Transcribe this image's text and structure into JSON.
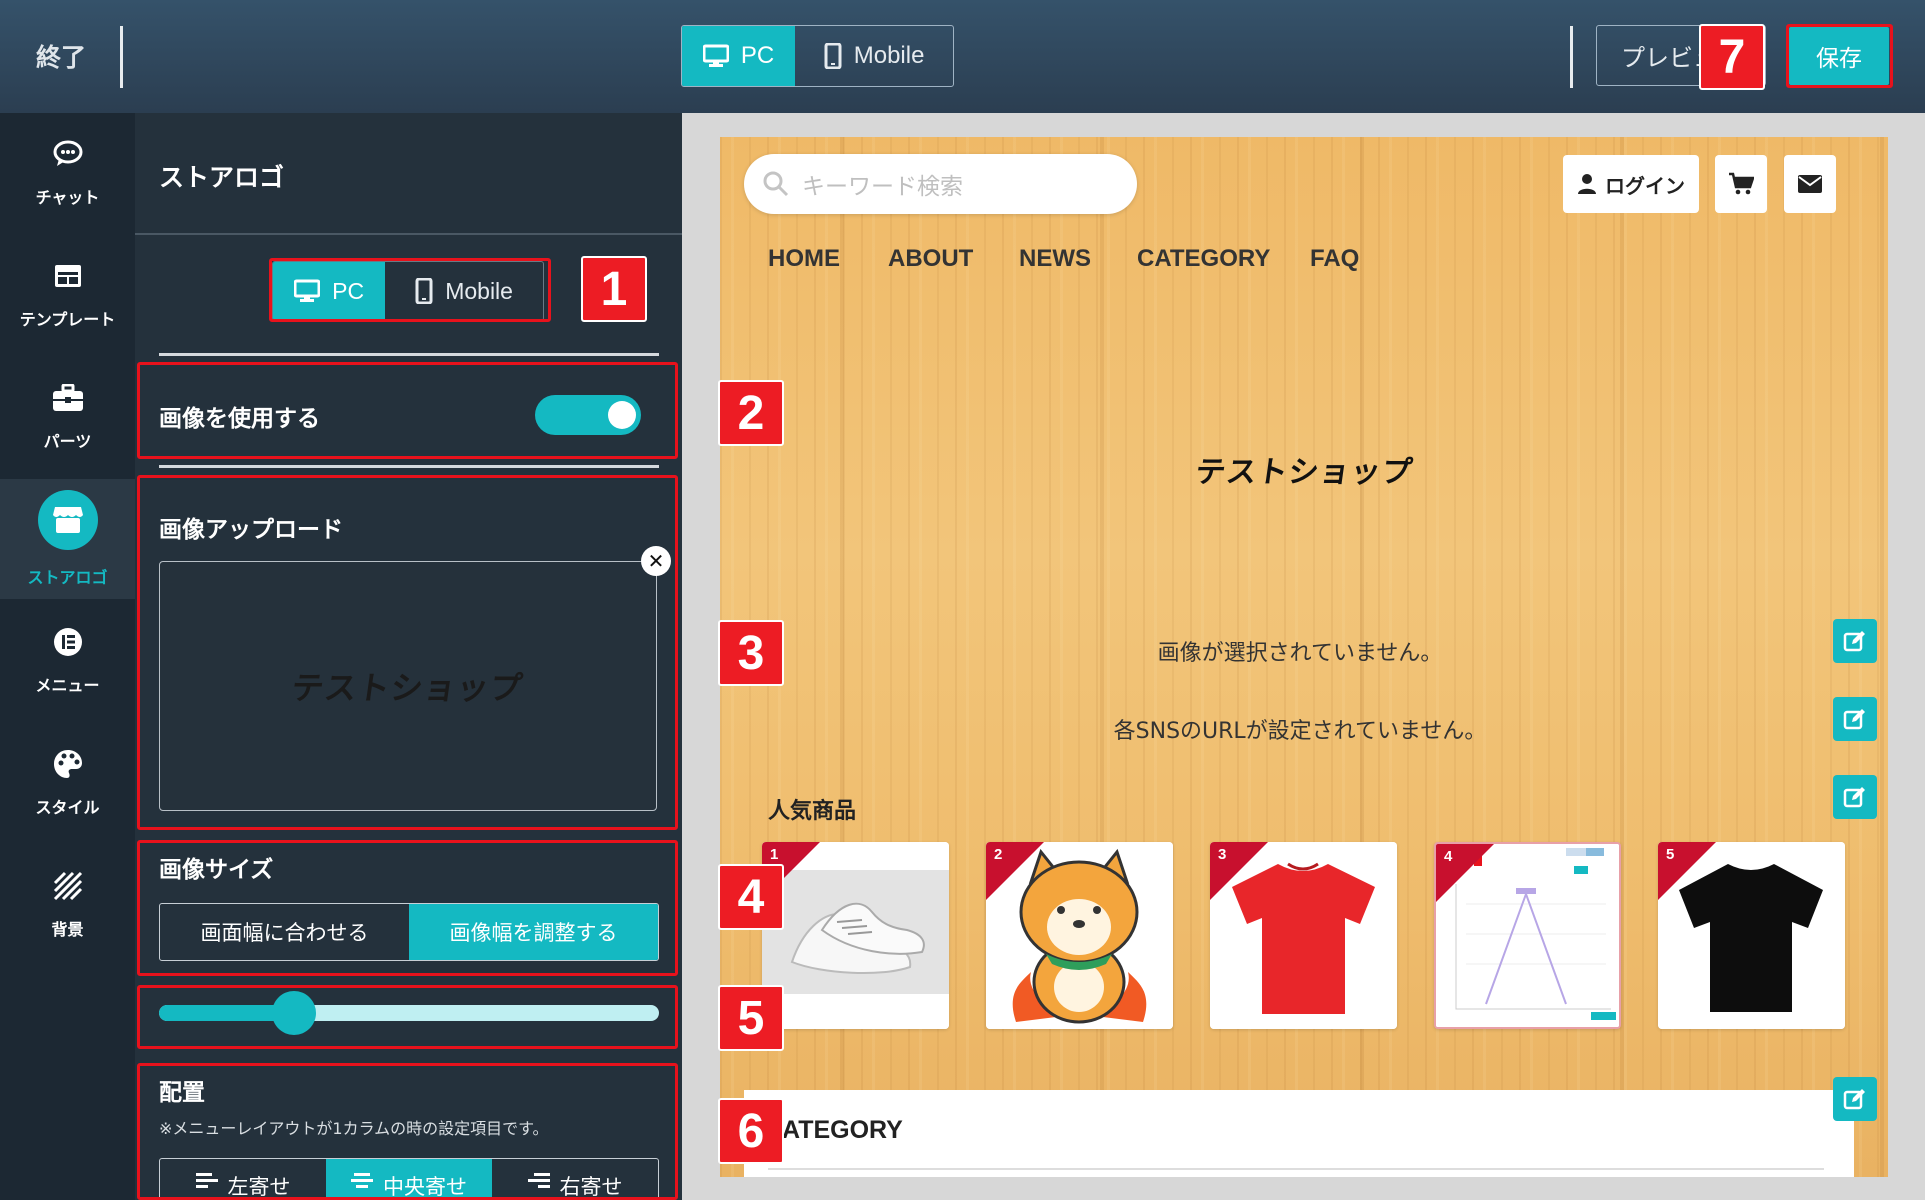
{
  "topbar": {
    "exit_label": "終了",
    "device_options": [
      "PC",
      "Mobile"
    ],
    "preview_label": "プレビュー",
    "save_label": "保存"
  },
  "rail": {
    "items": [
      {
        "label": "チャット",
        "icon": "chat-bubble-icon"
      },
      {
        "label": "テンプレート",
        "icon": "template-icon"
      },
      {
        "label": "パーツ",
        "icon": "toolbox-icon"
      },
      {
        "label": "ストアロゴ",
        "icon": "store-icon",
        "active": true
      },
      {
        "label": "メニュー",
        "icon": "menu-icon"
      },
      {
        "label": "スタイル",
        "icon": "palette-icon"
      },
      {
        "label": "背景",
        "icon": "hatch-icon"
      }
    ]
  },
  "panel": {
    "title": "ストアロゴ",
    "device_options": [
      "PC",
      "Mobile"
    ],
    "use_image_label": "画像を使用する",
    "use_image_on": true,
    "upload_label": "画像アップロード",
    "uploaded_logo_text": "テストショップ",
    "size_label": "画像サイズ",
    "size_options": [
      "画面幅に合わせる",
      "画像幅を調整する"
    ],
    "size_selected": 1,
    "slider_value_fraction": 0.27,
    "align_label": "配置",
    "align_note": "※メニューレイアウトが1カラムの時の設定項目です。",
    "align_options": [
      "左寄せ",
      "中央寄せ",
      "右寄せ"
    ],
    "align_selected": 1
  },
  "preview": {
    "search_placeholder": "キーワード検索",
    "login_label": "ログイン",
    "nav": [
      "HOME",
      "ABOUT",
      "NEWS",
      "CATEGORY",
      "FAQ"
    ],
    "shop_logo": "テストショップ",
    "no_image_msg": "画像が選択されていません。",
    "no_sns_msg": "各SNSのURLが設定されていません。",
    "popular_title": "人気商品",
    "products": [
      {
        "rank": "1",
        "image": "white-sneakers"
      },
      {
        "rank": "2",
        "image": "shiba-dog-illustration"
      },
      {
        "rank": "3",
        "image": "red-tshirt"
      },
      {
        "rank": "4",
        "image": "chart-screenshot"
      },
      {
        "rank": "5",
        "image": "black-tshirt"
      }
    ],
    "category_title": "ATEGORY"
  },
  "annotations": [
    "1",
    "2",
    "3",
    "4",
    "5",
    "6",
    "7"
  ],
  "colors": {
    "accent": "#14b9c2",
    "highlight": "#e8121c",
    "topbar": "#2f4559",
    "panel": "#24313c",
    "rail": "#1c2833"
  }
}
